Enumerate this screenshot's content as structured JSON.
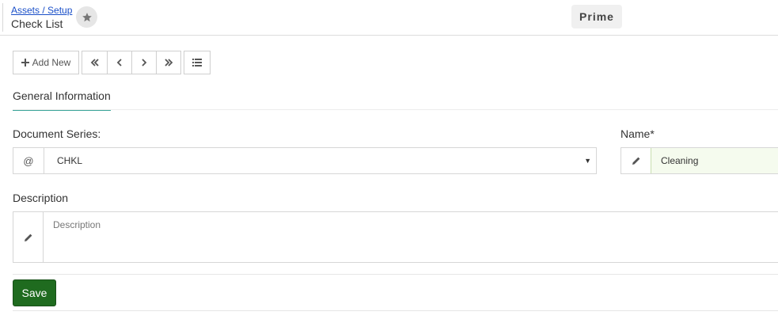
{
  "header": {
    "breadcrumb": "Assets / Setup",
    "title": "Check List",
    "badge": "Prime",
    "favorite_icon": "star-icon"
  },
  "toolbar": {
    "add_new_label": "Add New",
    "add_icon": "plus-icon",
    "nav_icons": [
      "first-icon",
      "previous-icon",
      "next-icon",
      "last-icon"
    ],
    "list_icon": "list-icon"
  },
  "tabs": [
    {
      "label": "General Information",
      "active": true
    }
  ],
  "form": {
    "document_series": {
      "label": "Document Series:",
      "addon": "@",
      "value": "CHKL"
    },
    "name": {
      "label": "Name*",
      "value": "Cleaning",
      "icon": "pencil-icon"
    },
    "description": {
      "label": "Description",
      "placeholder": "Description",
      "icon": "pencil-icon"
    }
  },
  "actions": {
    "save_label": "Save"
  },
  "colors": {
    "accent_tab": "#3aa59a",
    "save_button": "#1f6b1f",
    "name_field_bg": "#f5fbee"
  }
}
